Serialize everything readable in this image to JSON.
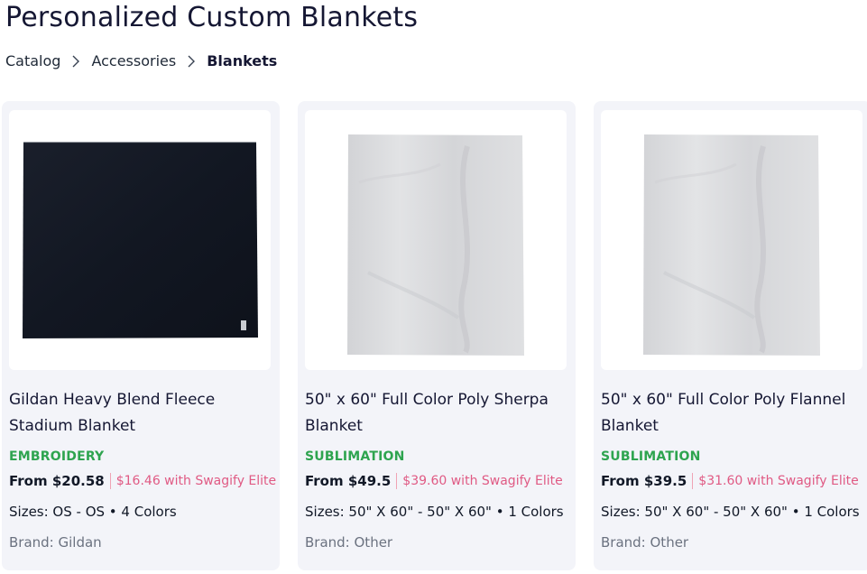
{
  "page": {
    "title": "Personalized Custom Blankets"
  },
  "breadcrumb": {
    "items": [
      "Catalog",
      "Accessories",
      "Blankets"
    ]
  },
  "colors": {
    "technique": "#2ea44f",
    "elite_price": "#e05a84",
    "card_bg": "#f3f4f9",
    "brand_text": "#6b7280"
  },
  "products": [
    {
      "name": "Gildan Heavy Blend Fleece Stadium Blanket",
      "technique": "EMBROIDERY",
      "price": "From $20.58",
      "elite_price": "$16.46 with Swagify Elite",
      "sizes": "Sizes: OS - OS • 4 Colors",
      "brand": "Brand: Gildan",
      "image": "black-fleece-blanket"
    },
    {
      "name": "50\" x 60\" Full Color Poly Sherpa Blanket",
      "technique": "SUBLIMATION",
      "price": "From $49.5",
      "elite_price": "$39.60 with Swagify Elite",
      "sizes": "Sizes: 50\" X 60\" - 50\" X 60\" • 1 Colors",
      "brand": "Brand: Other",
      "image": "white-sherpa-blanket"
    },
    {
      "name": "50\" x 60\" Full Color Poly Flannel Blanket",
      "technique": "SUBLIMATION",
      "price": "From $39.5",
      "elite_price": "$31.60 with Swagify Elite",
      "sizes": "Sizes: 50\" X 60\" - 50\" X 60\" • 1 Colors",
      "brand": "Brand: Other",
      "image": "white-flannel-blanket"
    }
  ]
}
